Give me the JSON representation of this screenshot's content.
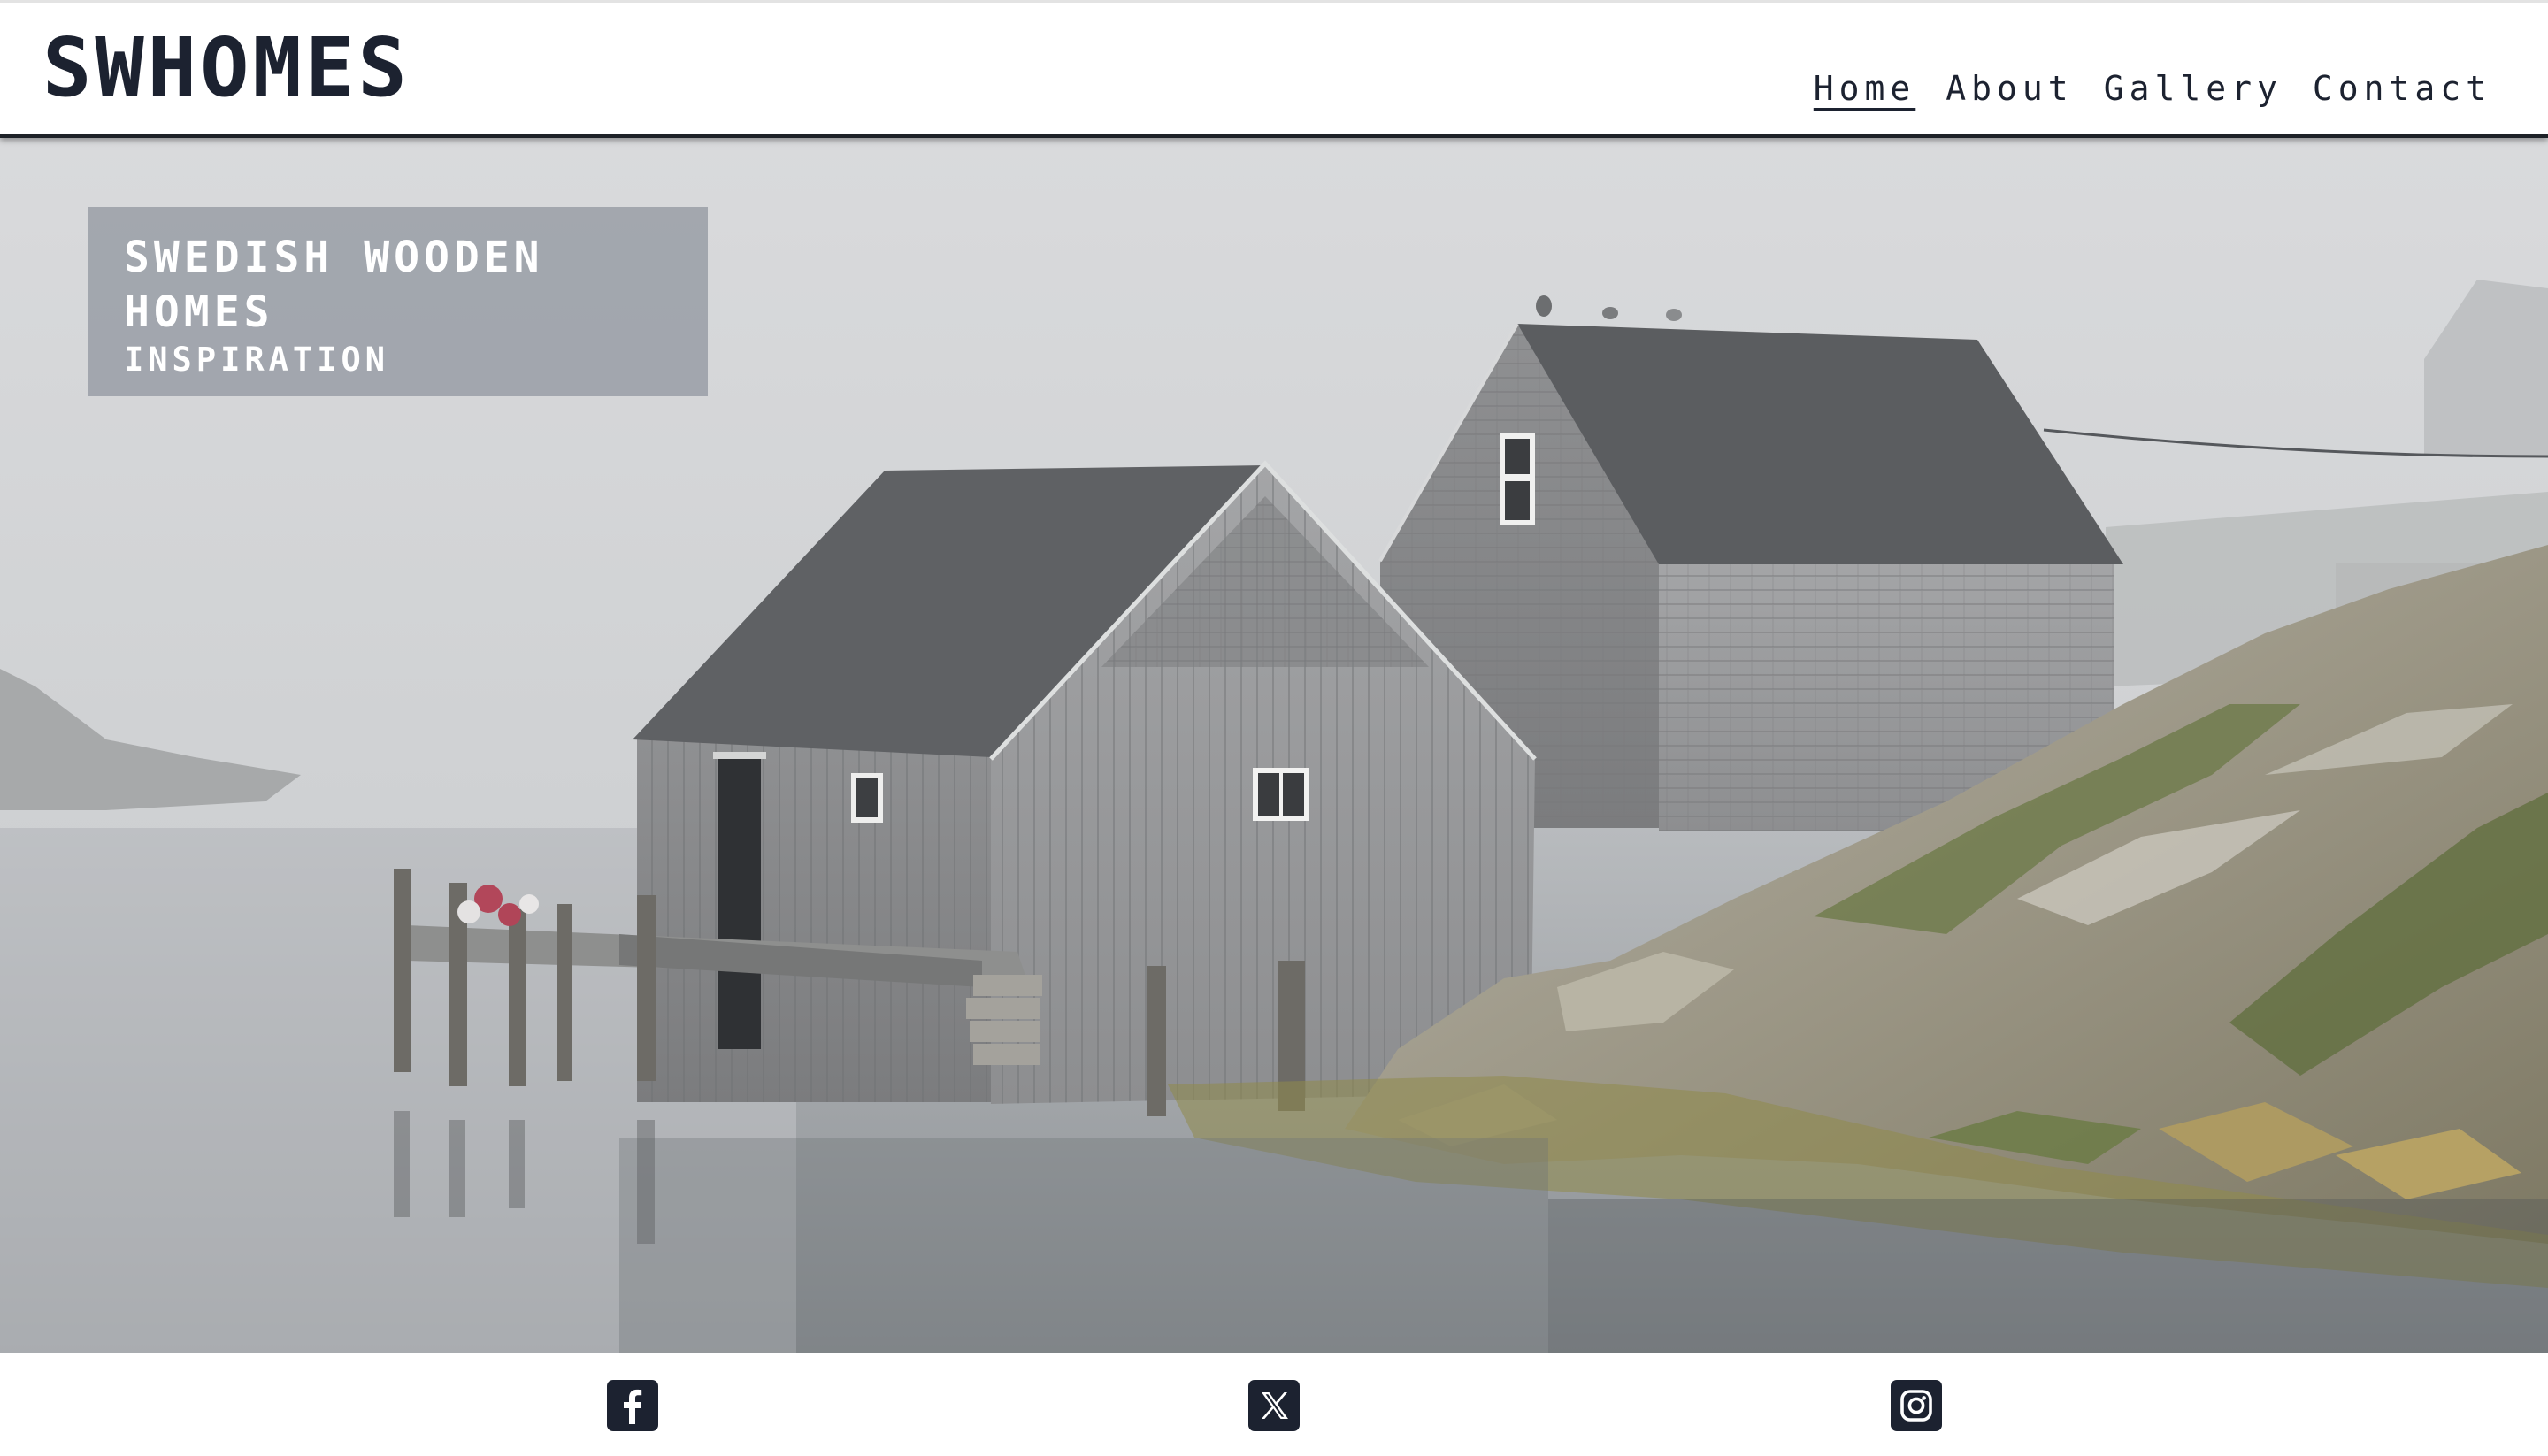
{
  "header": {
    "logo": "SWHOMES",
    "nav": {
      "home": "Home",
      "about": "About",
      "gallery": "Gallery",
      "contact": "Contact"
    },
    "active_nav": "Home"
  },
  "hero": {
    "title": "SWEDISH WOODEN HOMES",
    "subtitle": "INSPIRATION"
  },
  "footer": {
    "social_icons": [
      "facebook-icon",
      "x-icon",
      "instagram-icon"
    ]
  },
  "colors": {
    "text_dark": "#1c2230",
    "title_box": "#9498a2",
    "background": "#ffffff"
  }
}
